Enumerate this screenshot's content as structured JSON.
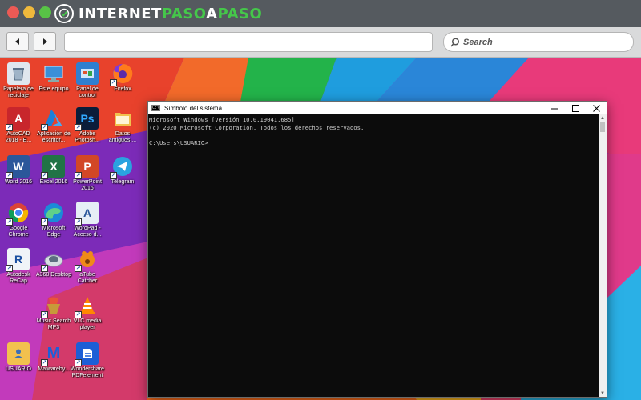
{
  "site": {
    "logo_part1": "INTERNET",
    "logo_part2": "PASO",
    "logo_part3": "A",
    "logo_part4": "PASO"
  },
  "browser": {
    "search_placeholder": "Search",
    "url_value": ""
  },
  "desktop_icons": [
    {
      "label": "Papelera de reciclaje",
      "icon": "recycle-bin-icon",
      "color": "#dfe6ee"
    },
    {
      "label": "Este equipo",
      "icon": "computer-icon",
      "color": "#3a8fd8"
    },
    {
      "label": "Panel de control",
      "icon": "control-panel-icon",
      "color": "#2f7fd0"
    },
    {
      "label": "Firefox",
      "icon": "firefox-icon",
      "color": "#ff7b1c"
    },
    {
      "label": "AutoCAD 2018 - E...",
      "icon": "autocad-icon",
      "color": "#c8262c"
    },
    {
      "label": "Aplicación de escritor...",
      "icon": "azure-icon",
      "color": "#1e7fd6"
    },
    {
      "label": "Adobe Photosh...",
      "icon": "photoshop-icon",
      "color": "#0a1d3a"
    },
    {
      "label": "Datos antiguos ...",
      "icon": "folder-icon",
      "color": "#f2c14e"
    },
    {
      "label": "Word 2016",
      "icon": "word-icon",
      "color": "#2b579a"
    },
    {
      "label": "Excel 2016",
      "icon": "excel-icon",
      "color": "#217346"
    },
    {
      "label": "PowerPoint 2016",
      "icon": "powerpoint-icon",
      "color": "#d24726"
    },
    {
      "label": "Telegram",
      "icon": "telegram-icon",
      "color": "#2aa3e0"
    },
    {
      "label": "Google Chrome",
      "icon": "chrome-icon",
      "color": "#4285f4"
    },
    {
      "label": "Microsoft Edge",
      "icon": "edge-icon",
      "color": "#1b8ad8"
    },
    {
      "label": "WordPad - Acceso d...",
      "icon": "wordpad-icon",
      "color": "#e6eef6"
    },
    {
      "label": "Autodesk ReCap",
      "icon": "recap-icon",
      "color": "#f0f4f8"
    },
    {
      "label": "A360 Desktop",
      "icon": "a360-icon",
      "color": "#d8dde3"
    },
    {
      "label": "aTube Catcher",
      "icon": "atube-icon",
      "color": "#f08a18"
    },
    {
      "label": "Music Search MP3",
      "icon": "music-search-icon",
      "color": "#c79a3a"
    },
    {
      "label": "VLC media player",
      "icon": "vlc-icon",
      "color": "#ff8800"
    },
    {
      "label": "USUARIO",
      "icon": "user-folder-icon",
      "color": "#f2c14e"
    },
    {
      "label": "Malwareby...",
      "icon": "malwarebytes-icon",
      "color": "#1f5fd8"
    },
    {
      "label": "Wondershare PDFelement",
      "icon": "pdfelement-icon",
      "color": "#1c5ed6"
    }
  ],
  "cmd": {
    "title": "Símbolo del sistema",
    "lines": [
      "Microsoft Windows [Versión 10.0.19041.685]",
      "(c) 2020 Microsoft Corporation. Todos los derechos reservados.",
      "",
      "C:\\Users\\USUARIO>"
    ]
  },
  "colors": {
    "logo_green": "#45c74a",
    "cmd_bg": "#0c0c0c",
    "cmd_text": "#cccccc"
  }
}
